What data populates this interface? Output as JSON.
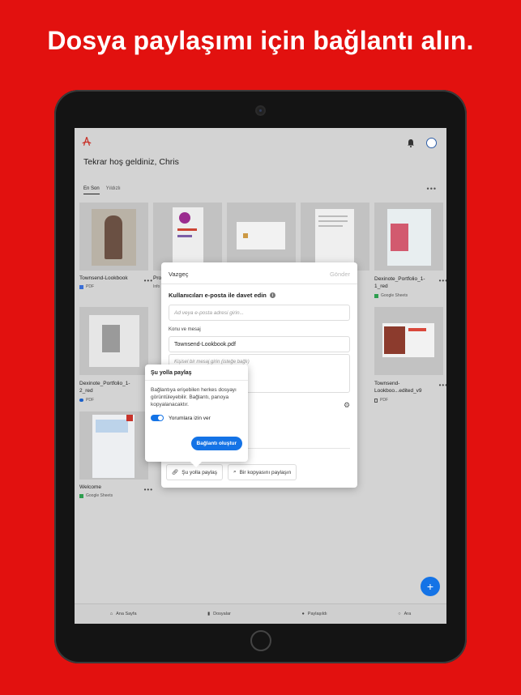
{
  "headline": "Dosya paylaşımı için bağlantı alın.",
  "colors": {
    "background": "#e2110f",
    "accent": "#1473e6"
  },
  "app": {
    "welcome": "Tekrar hoş geldiniz, Chris",
    "tabs": [
      "En Son",
      "Yıldızlı"
    ],
    "files": [
      {
        "name": "Townsend-Lookbook",
        "meta": "PDF",
        "icon": "dropbox-icon"
      },
      {
        "name": "Pro",
        "meta": "",
        "icon": "pdf-icon"
      },
      {
        "name": "",
        "meta": "",
        "icon": ""
      },
      {
        "name": "",
        "meta": "",
        "icon": ""
      },
      {
        "name": "Dexinote_Portfolio_1-1_red",
        "meta": "Google Sheets",
        "icon": "google-drive-icon"
      },
      {
        "name": "Dexinote_Portfolio_1-2_red",
        "meta": "PDF",
        "icon": "onedrive-icon"
      },
      {
        "name": "Townsend-Lookboo...edited_v9",
        "meta": "PDF",
        "icon": "device-icon"
      },
      {
        "name": "Welcome",
        "meta": "Google Sheets",
        "icon": "google-drive-icon"
      }
    ],
    "truncated_label_2": "Info",
    "nav": [
      {
        "label": "Ana Sayfa",
        "icon": "home-icon"
      },
      {
        "label": "Dosyalar",
        "icon": "file-icon"
      },
      {
        "label": "Paylaşıldı",
        "icon": "people-icon"
      },
      {
        "label": "Ara",
        "icon": "search-icon"
      }
    ]
  },
  "share_dialog": {
    "cancel": "Vazgeç",
    "send": "Gönder",
    "invite_title": "Kullanıcıları e-posta ile davet edin",
    "email_placeholder": "Ad veya e-posta adresi girin...",
    "subject_label": "Konu ve mesaj",
    "subject_value": "Townsend-Lookbook.pdf",
    "message_placeholder": "Kişisel bir mesaj girin (isteğe bağlı)",
    "share_link_button": "Şu yolla paylaş",
    "share_copy_button": "Bir kopyasını paylaşın"
  },
  "link_popover": {
    "title": "Şu yolla paylaş",
    "description": "Bağlantıya erişebilen herkes dosyayı görüntüleyebilir. Bağlantı, panoya kopyalanacaktır.",
    "comments_toggle_label": "Yorumlara izin ver",
    "comments_enabled": true,
    "create_link_button": "Bağlantı oluştur"
  }
}
